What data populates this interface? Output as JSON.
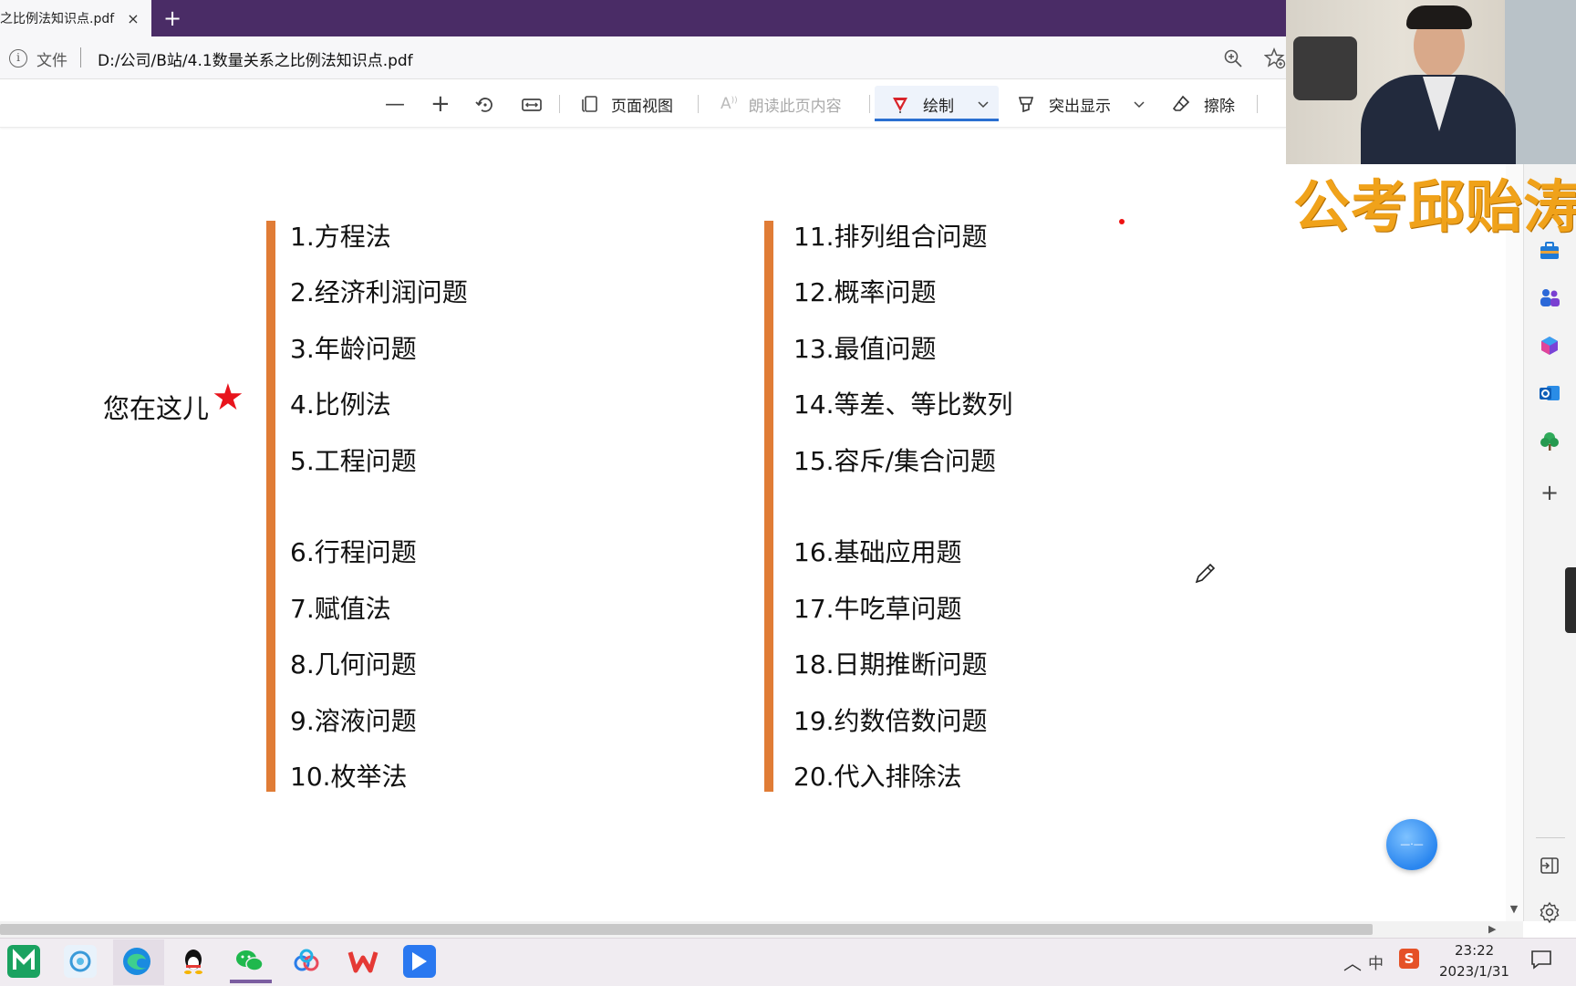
{
  "tab": {
    "title": "之比例法知识点.pdf",
    "close": "×",
    "new_tab": "+"
  },
  "address": {
    "info": "i",
    "label": "文件",
    "url": "D:/公司/B站/4.1数量关系之比例法知识点.pdf"
  },
  "toolbar": {
    "zoom_out": "—",
    "zoom_in": "+",
    "page_view": "页面视图",
    "read_aloud": "朗读此页内容",
    "draw": "绘制",
    "highlight": "突出显示",
    "erase": "擦除"
  },
  "webcam": {
    "overlay_text": "公考邱贻涛"
  },
  "document": {
    "you_are_here": "您在这儿",
    "star": "★",
    "left_group_a": [
      "1.方程法",
      "2.经济利润问题",
      "3.年龄问题",
      "4.比例法",
      "5.工程问题"
    ],
    "left_group_b": [
      "6.行程问题",
      "7.赋值法",
      "8.几何问题",
      "9.溶液问题",
      "10.枚举法"
    ],
    "right_group_a": [
      "11.排列组合问题",
      "12.概率问题",
      "13.最值问题",
      "14.等差、等比数列",
      "15.容斥/集合问题"
    ],
    "right_group_b": [
      "16.基础应用题",
      "17.牛吃草问题",
      "18.日期推断问题",
      "19.约数倍数问题",
      "20.代入排除法"
    ]
  },
  "sidebar": {
    "icons": [
      "briefcase-icon",
      "people-icon",
      "office-icon",
      "outlook-icon",
      "tree-icon",
      "add-icon",
      "exit-icon",
      "settings-icon"
    ]
  },
  "taskbar": {
    "apps": [
      "maxthon-icon",
      "app-icon",
      "edge-icon",
      "qq-icon",
      "wechat-icon",
      "baidu-netdisk-icon",
      "wps-icon",
      "feishu-icon"
    ],
    "tray_ime": "中",
    "tray_s": "S",
    "time": "23:22",
    "date": "2023/1/31"
  },
  "colors": {
    "tab_bar": "#4a2c66",
    "orange_bar": "#e07c36",
    "star": "#e8141c",
    "overlay_text": "#f0a21a",
    "draw_accent": "#2a6fd1"
  }
}
